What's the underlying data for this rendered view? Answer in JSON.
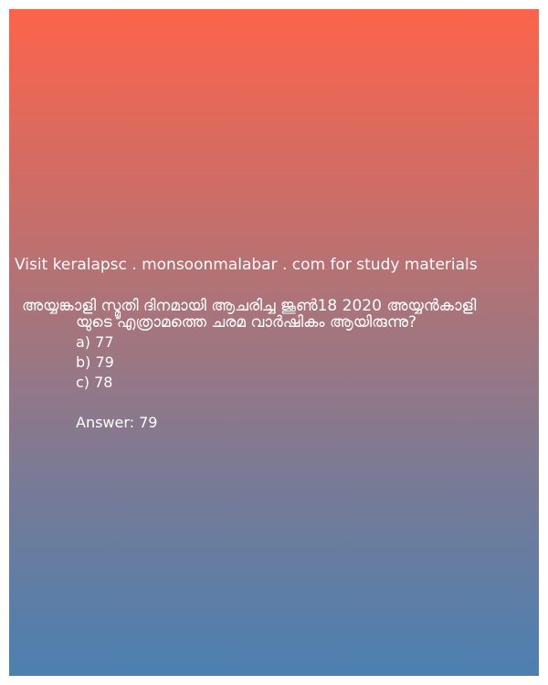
{
  "promo": {
    "text": "Visit keralapsc . monsoonmalabar . com for study materials"
  },
  "question": {
    "line1": "അയ്യങ്കാളി സ്മൃതി ദിനമായി ആചരിച്ച ജൂൺ18 2020 അയ്യൻകാളി",
    "line2": "യുടെ എത്രാമത്തെ ചരമ വാർഷികം ആയിരുന്നു?"
  },
  "options": [
    "a) 77",
    "b) 79",
    "c) 78"
  ],
  "answer": {
    "text": "Answer: 79"
  },
  "colors": {
    "gradient_top": "#fd644b",
    "gradient_bottom": "#4b80b1",
    "text": "#ffffff"
  }
}
